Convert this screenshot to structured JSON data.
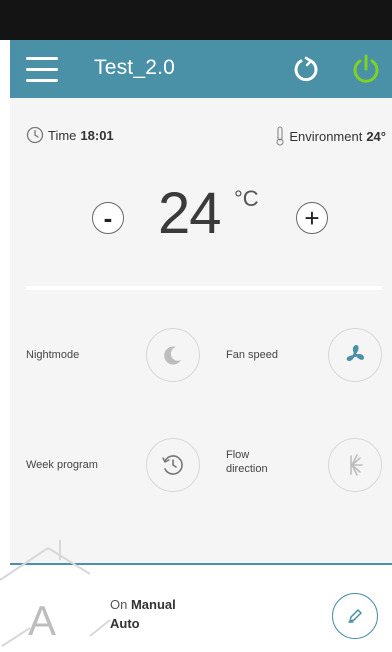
{
  "header": {
    "title": "Test_2.0",
    "menu_icon": "hamburger-menu-icon",
    "refresh_icon": "refresh-icon",
    "power_icon": "power-icon"
  },
  "info": {
    "time_label": "Time",
    "time_value": "18:01",
    "environment_label": "Environment",
    "environment_value": "24°"
  },
  "temperature": {
    "value": "24",
    "unit": "°C",
    "minus_label": "-",
    "plus_label": "+"
  },
  "features": {
    "nightmode_label": "Nightmode",
    "fan_speed_label": "Fan speed",
    "week_program_label": "Week program",
    "flow_direction_label_1": "Flow",
    "flow_direction_label_2": "direction"
  },
  "mode": {
    "letter": "A",
    "on_label": "On",
    "manual_label": "Manual",
    "auto_label": "Auto",
    "edit_icon": "pencil-icon"
  },
  "colors": {
    "accent": "#4a90a6",
    "power": "#7ed321",
    "statusbar": "#141414"
  }
}
